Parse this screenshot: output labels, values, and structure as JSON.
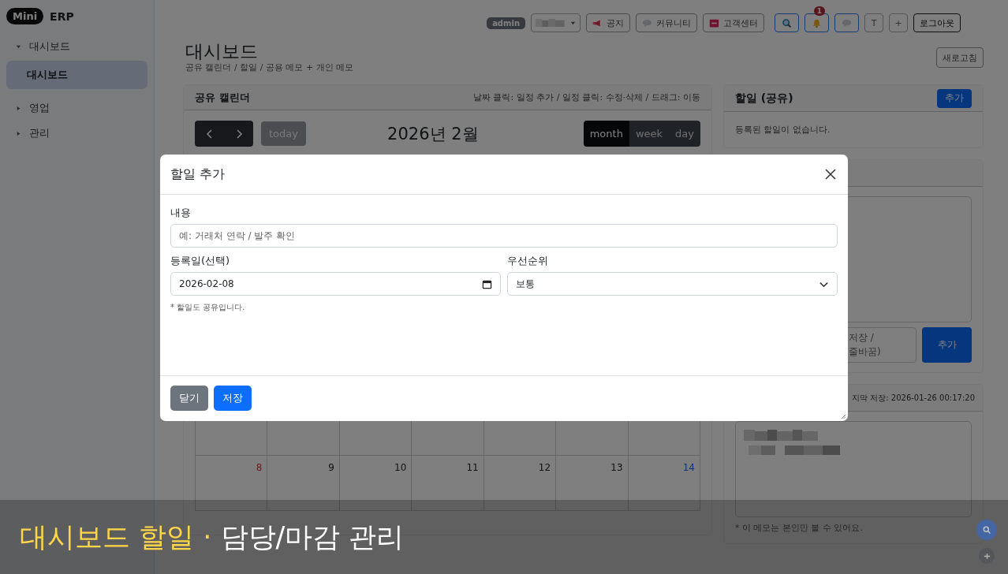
{
  "sidebar": {
    "brand": {
      "badge": "Mini",
      "name": "ERP"
    },
    "items": [
      {
        "label": "대시보드",
        "expanded": true,
        "children": [
          {
            "label": "대시보드",
            "selected": true
          }
        ]
      },
      {
        "label": "영업",
        "expanded": false
      },
      {
        "label": "관리",
        "expanded": false
      }
    ]
  },
  "topbar": {
    "role_badge": "admin",
    "links": [
      {
        "label": "공지"
      },
      {
        "label": "커뮤니티"
      },
      {
        "label": "고객센터"
      }
    ],
    "tools": [
      {
        "kind": "search"
      },
      {
        "kind": "bell",
        "badge": "1"
      },
      {
        "kind": "chat"
      },
      {
        "kind": "text",
        "label": "T"
      },
      {
        "kind": "text",
        "label": "+"
      }
    ],
    "logout": "로그아웃"
  },
  "page": {
    "title": "대시보드",
    "subtitle": "공유 캘린더 / 할일 / 공용 메모 + 개인 메모",
    "refresh": "새로고침"
  },
  "calendar": {
    "title": "공유 캘린더",
    "hint": "날짜 클릭: 일정 추가 / 일정 클릭: 수정·삭제 / 드래그: 이동",
    "today": "today",
    "month_title": "2026년 2월",
    "views": [
      {
        "label": "month",
        "selected": true
      },
      {
        "label": "week",
        "selected": false
      },
      {
        "label": "day",
        "selected": false
      }
    ],
    "weeks": [
      {
        "days": [
          {
            "number": "8",
            "kind": "sunday"
          },
          {
            "number": "9",
            "kind": "weekday"
          },
          {
            "number": "10",
            "kind": "weekday"
          },
          {
            "number": "11",
            "kind": "weekday"
          },
          {
            "number": "12",
            "kind": "weekday"
          },
          {
            "number": "13",
            "kind": "weekday"
          },
          {
            "number": "14",
            "kind": "saturday"
          }
        ]
      }
    ]
  },
  "todo": {
    "title": "할일 (공유)",
    "add": "추가",
    "empty": "등록된 할일이 없습니다."
  },
  "shared_memo": {
    "input_lines": [
      "저장 /",
      "줄바꿈)"
    ],
    "add": "추가"
  },
  "personal_memo": {
    "saved": "지막 저장: 2026-01-26 00:17:20",
    "note": "* 이 메모는 본인만 볼 수 있어요."
  },
  "modal": {
    "title": "할일 추가",
    "fields": [
      {
        "label": "내용",
        "kind": "text",
        "placeholder": "예: 거래처 연락 / 발주 확인"
      },
      {
        "label": "등록일(선택)",
        "kind": "date",
        "value": "2026-02-08"
      },
      {
        "label": "우선순위",
        "kind": "select",
        "value": "보통"
      }
    ],
    "hint": "* 할일도 공유입니다.",
    "buttons": [
      {
        "label": "닫기",
        "kind": "secondary"
      },
      {
        "label": "저장",
        "kind": "primary"
      }
    ]
  },
  "caption": {
    "highlight": "대시보드 할일 ·",
    "text": "담당/마감 관리"
  }
}
